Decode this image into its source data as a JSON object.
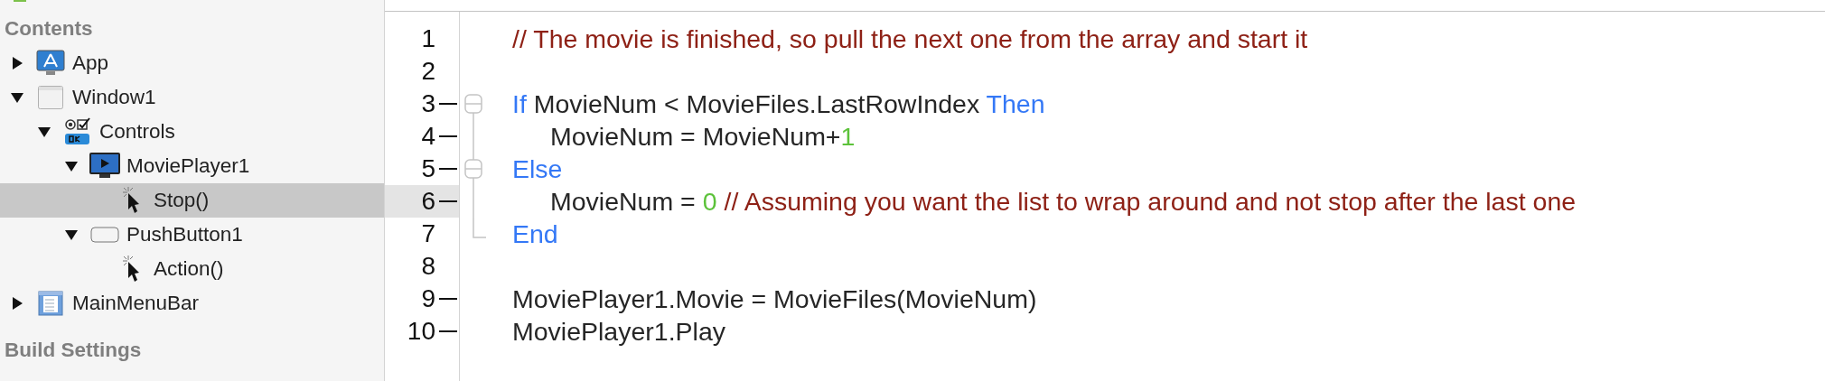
{
  "sidebar": {
    "sections": [
      {
        "title": "Contents",
        "items": [
          {
            "label": "App",
            "kind": "app",
            "expanded": false,
            "selected": false
          },
          {
            "label": "Window1",
            "kind": "window",
            "expanded": true,
            "selected": false,
            "children": [
              {
                "label": "Controls",
                "kind": "controls",
                "expanded": true,
                "selected": false,
                "children": [
                  {
                    "label": "MoviePlayer1",
                    "kind": "movie-player",
                    "expanded": true,
                    "selected": false,
                    "children": [
                      {
                        "label": "Stop()",
                        "kind": "method",
                        "selected": true
                      }
                    ]
                  },
                  {
                    "label": "PushButton1",
                    "kind": "push-button",
                    "expanded": true,
                    "selected": false,
                    "children": [
                      {
                        "label": "Action()",
                        "kind": "method",
                        "selected": false
                      }
                    ]
                  }
                ]
              }
            ]
          },
          {
            "label": "MainMenuBar",
            "kind": "menu-bar",
            "expanded": false,
            "selected": false
          }
        ]
      },
      {
        "title": "Build Settings"
      }
    ]
  },
  "editor": {
    "lines": [
      {
        "number": "1",
        "kind": "plain",
        "marked": false,
        "current": false,
        "tokens": [
          {
            "kind": "comment",
            "text": "// The movie is finished, so pull the next one from the array and start it"
          }
        ]
      },
      {
        "number": "2",
        "kind": "plain",
        "marked": false,
        "current": false
      },
      {
        "number": "3",
        "kind": "fold-start",
        "marked": true,
        "current": false,
        "tokens": [
          {
            "kind": "keyword",
            "text": "If"
          },
          {
            "kind": "plain",
            "text": " MovieNum < MovieFiles.LastRowIndex "
          },
          {
            "kind": "keyword",
            "text": "Then"
          }
        ],
        "children": [
          {
            "number": "4",
            "kind": "fold-line",
            "marked": true,
            "current": false,
            "tokens": [
              {
                "kind": "plain",
                "text": "MovieNum = MovieNum+"
              },
              {
                "kind": "number",
                "text": "1"
              }
            ]
          }
        ]
      },
      {
        "number": "5",
        "kind": "fold-branch",
        "marked": true,
        "current": false,
        "tokens": [
          {
            "kind": "keyword",
            "text": "Else"
          }
        ],
        "children": [
          {
            "number": "6",
            "kind": "fold-line",
            "marked": true,
            "current": true,
            "tokens": [
              {
                "kind": "plain",
                "text": "MovieNum = "
              },
              {
                "kind": "number",
                "text": "0"
              },
              {
                "kind": "comment",
                "text": " // Assuming you want the list to wrap around and not stop after the last one"
              }
            ]
          }
        ]
      },
      {
        "number": "7",
        "kind": "fold-end",
        "marked": false,
        "current": false,
        "tokens": [
          {
            "kind": "keyword",
            "text": "End"
          }
        ]
      },
      {
        "number": "8",
        "kind": "plain",
        "marked": false,
        "current": false
      },
      {
        "number": "9",
        "kind": "plain",
        "marked": true,
        "current": false,
        "tokens": [
          {
            "kind": "plain",
            "text": "MoviePlayer1.Movie = MovieFiles(MovieNum)"
          }
        ]
      },
      {
        "number": "10",
        "kind": "plain",
        "marked": true,
        "current": false,
        "tokens": [
          {
            "kind": "plain",
            "text": "MoviePlayer1.Play"
          }
        ]
      }
    ]
  }
}
